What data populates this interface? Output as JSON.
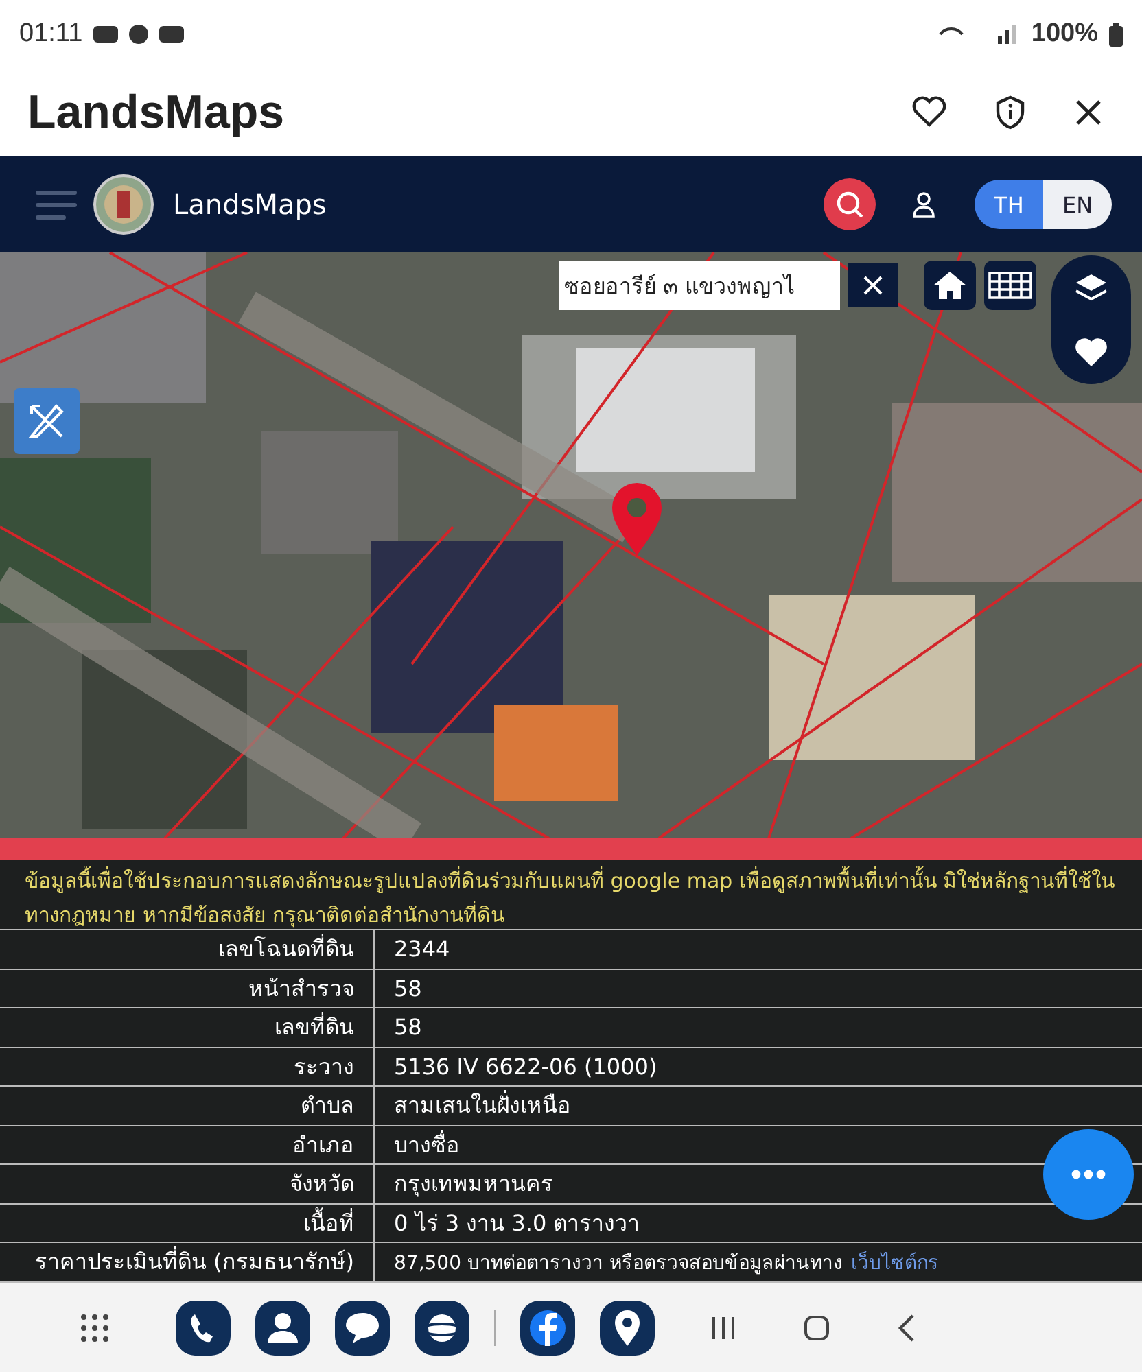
{
  "status_bar": {
    "time": "01:11",
    "battery": "100%"
  },
  "app_bar": {
    "title": "LandsMaps"
  },
  "site_header": {
    "brand": "LandsMaps",
    "languages": [
      {
        "label": "TH",
        "selected": true
      },
      {
        "label": "EN",
        "selected": false
      }
    ]
  },
  "map": {
    "search": {
      "value": "ซอยอารีย์ ๓ แขวงพญาไ"
    }
  },
  "disclaimer": "ข้อมูลนี้เพื่อใช้ประกอบการแสดงลักษณะรูปแปลงที่ดินร่วมกับแผนที่ google map เพื่อดูสภาพพื้นที่เท่านั้น มิใช่หลักฐานที่ใช้ในทางกฎหมาย หากมีข้อสงสัย กรุณาติดต่อสำนักงานที่ดิน",
  "parcel_table": {
    "rows": [
      {
        "label": "เลขโฉนดที่ดิน",
        "value": "2344"
      },
      {
        "label": "หน้าสำรวจ",
        "value": "58"
      },
      {
        "label": "เลขที่ดิน",
        "value": "58"
      },
      {
        "label": "ระวาง",
        "value": "5136 IV 6622-06 (1000)"
      },
      {
        "label": "ตำบล",
        "value": "สามเสนในฝั่งเหนือ"
      },
      {
        "label": "อำเภอ",
        "value": "บางซื่อ"
      },
      {
        "label": "จังหวัด",
        "value": "กรุงเทพมหานคร"
      },
      {
        "label": "เนื้อที่",
        "value": "0 ไร่ 3 งาน 3.0 ตารางวา"
      },
      {
        "label": "ราคาประเมินที่ดิน (กรมธนารักษ์)",
        "value": "87,500 บาทต่อตารางวา หรือตรวจสอบข้อมูลผ่านทาง",
        "link": "เว็บไซต์กร"
      }
    ]
  }
}
